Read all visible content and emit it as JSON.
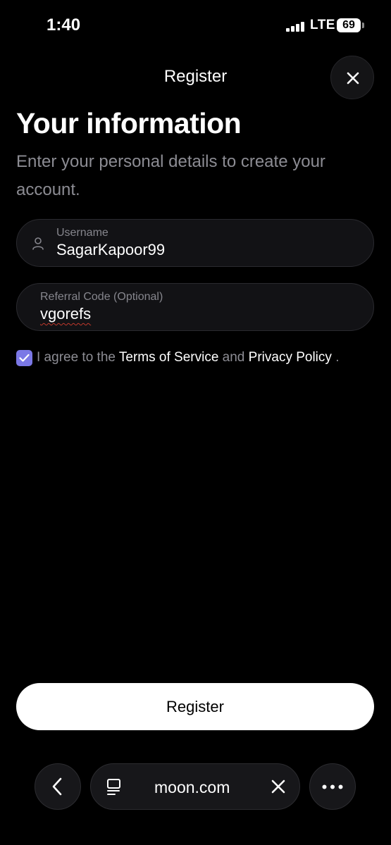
{
  "status_bar": {
    "time": "1:40",
    "network": "LTE",
    "battery": "69"
  },
  "header": {
    "title": "Register"
  },
  "main": {
    "title": "Your information",
    "subtitle": "Enter your personal details to create your account."
  },
  "form": {
    "username": {
      "label": "Username",
      "value": "SagarKapoor99"
    },
    "referral": {
      "label": "Referral Code (Optional)",
      "value": "vgorefs"
    },
    "agreement": {
      "checked": true,
      "prefix": "I agree to the",
      "terms": "Terms of Service",
      "and": "and",
      "privacy": "Privacy Policy",
      "suffix": "."
    }
  },
  "register_button": {
    "label": "Register"
  },
  "browser": {
    "url": "moon.com"
  },
  "colors": {
    "accent": "#7b78e6",
    "background": "#000000",
    "button": "#ffffff"
  }
}
